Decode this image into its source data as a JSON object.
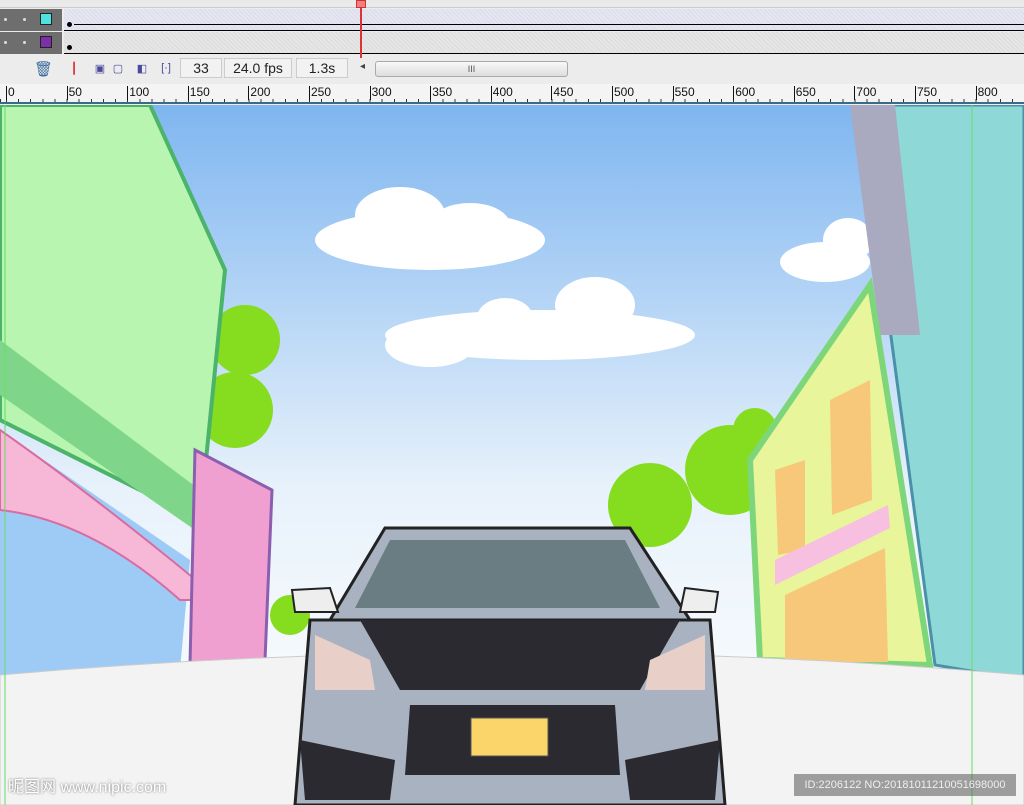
{
  "timeline": {
    "layers": [
      {
        "color": "#4fe3e0"
      },
      {
        "color": "#7b2fa8"
      }
    ],
    "current_frame": "33",
    "fps": "24.0 fps",
    "elapsed": "1.3s",
    "scroll_thumb": "III"
  },
  "ruler": {
    "labels": [
      "0",
      "50",
      "100",
      "150",
      "200",
      "250",
      "300",
      "350",
      "400",
      "450",
      "500",
      "550",
      "600",
      "650",
      "700",
      "750",
      "800"
    ]
  },
  "watermark": {
    "left": "昵图网 www.nipic.com",
    "right": "ID:2206122 NO:20181011210051698000"
  }
}
